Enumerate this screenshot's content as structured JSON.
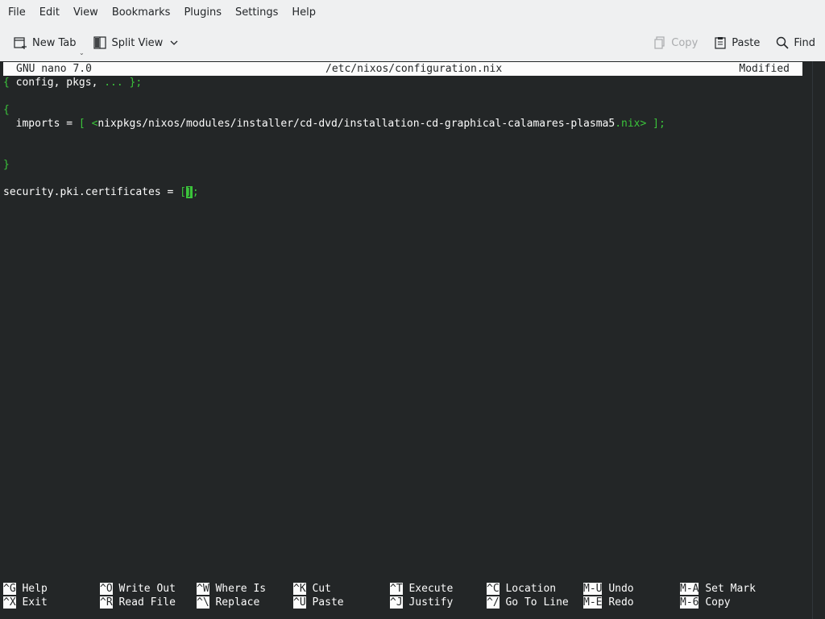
{
  "menubar": {
    "items": [
      "File",
      "Edit",
      "View",
      "Bookmarks",
      "Plugins",
      "Settings",
      "Help"
    ]
  },
  "toolbar": {
    "new_tab": "New Tab",
    "split_view": "Split View",
    "copy": "Copy",
    "paste": "Paste",
    "find": "Find"
  },
  "nano": {
    "version": "GNU nano 7.0",
    "filename": "/etc/nixos/configuration.nix",
    "status": "Modified",
    "lines": {
      "l1_open": "{",
      "l1_args": " config, pkgs, ",
      "l1_dots": "...",
      "l1_close": " };",
      "l3": "{",
      "l4_prefix": "  imports = ",
      "l4_bracket_open": "[",
      "l4_space": " ",
      "l4_path_open": "<",
      "l4_path": "nixpkgs/nixos/modules/installer/cd-dvd/installation-cd-graphical-calamares-plasma5",
      "l4_ext": ".nix",
      "l4_path_close": ">",
      "l4_end": " ];",
      "l7": "}",
      "l9_prefix": "security.pki.certificates = ",
      "l9_bracket": "[",
      "l9_cursor": "]",
      "l9_end": ";"
    },
    "shortcuts": [
      {
        "key": "^G",
        "label": "Help"
      },
      {
        "key": "^O",
        "label": "Write Out"
      },
      {
        "key": "^W",
        "label": "Where Is"
      },
      {
        "key": "^K",
        "label": "Cut"
      },
      {
        "key": "^T",
        "label": "Execute"
      },
      {
        "key": "^C",
        "label": "Location"
      },
      {
        "key": "M-U",
        "label": "Undo"
      },
      {
        "key": "M-A",
        "label": "Set Mark"
      },
      {
        "key": "^X",
        "label": "Exit"
      },
      {
        "key": "^R",
        "label": "Read File"
      },
      {
        "key": "^\\",
        "label": "Replace"
      },
      {
        "key": "^U",
        "label": "Paste"
      },
      {
        "key": "^J",
        "label": "Justify"
      },
      {
        "key": "^/",
        "label": "Go To Line"
      },
      {
        "key": "M-E",
        "label": "Redo"
      },
      {
        "key": "M-6",
        "label": "Copy"
      }
    ]
  }
}
